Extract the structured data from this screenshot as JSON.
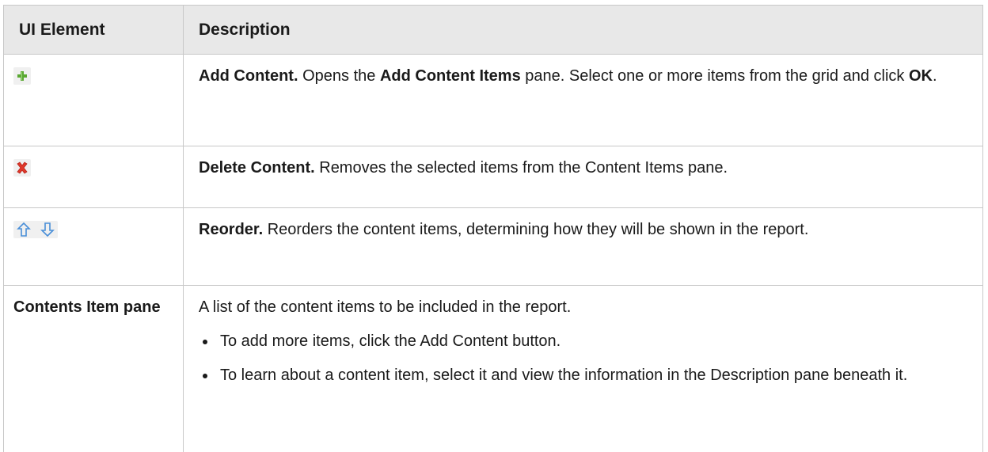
{
  "header": {
    "col1": "UI Element",
    "col2": "Description"
  },
  "rows": [
    {
      "icon": "add-icon",
      "title": "Add Content.",
      "text1": " Opens the ",
      "bold2": "Add Content Items",
      "text2": " pane. Select one or more items from the grid and click ",
      "bold3": "OK",
      "text3": "."
    },
    {
      "icon": "delete-icon",
      "title": "Delete Content.",
      "text1": " Removes the selected items from the Content Items pane."
    },
    {
      "icons": [
        "arrow-up-icon",
        "arrow-down-icon"
      ],
      "title": "Reorder.",
      "text1": " Reorders the content items, determining how they will be shown in the report."
    },
    {
      "label": "Contents Item pane",
      "text1": "A list of the content items to be included in the report.",
      "bullets": [
        "To add more items, click the Add Content button.",
        "To learn about a content item, select it and view the information in the Description pane beneath it."
      ]
    }
  ],
  "colors": {
    "header_bg": "#e8e8e8",
    "border": "#c8c8c8",
    "add_green": "#5aa832",
    "delete_red": "#e0392b",
    "arrow_blue": "#4a8fd8"
  }
}
